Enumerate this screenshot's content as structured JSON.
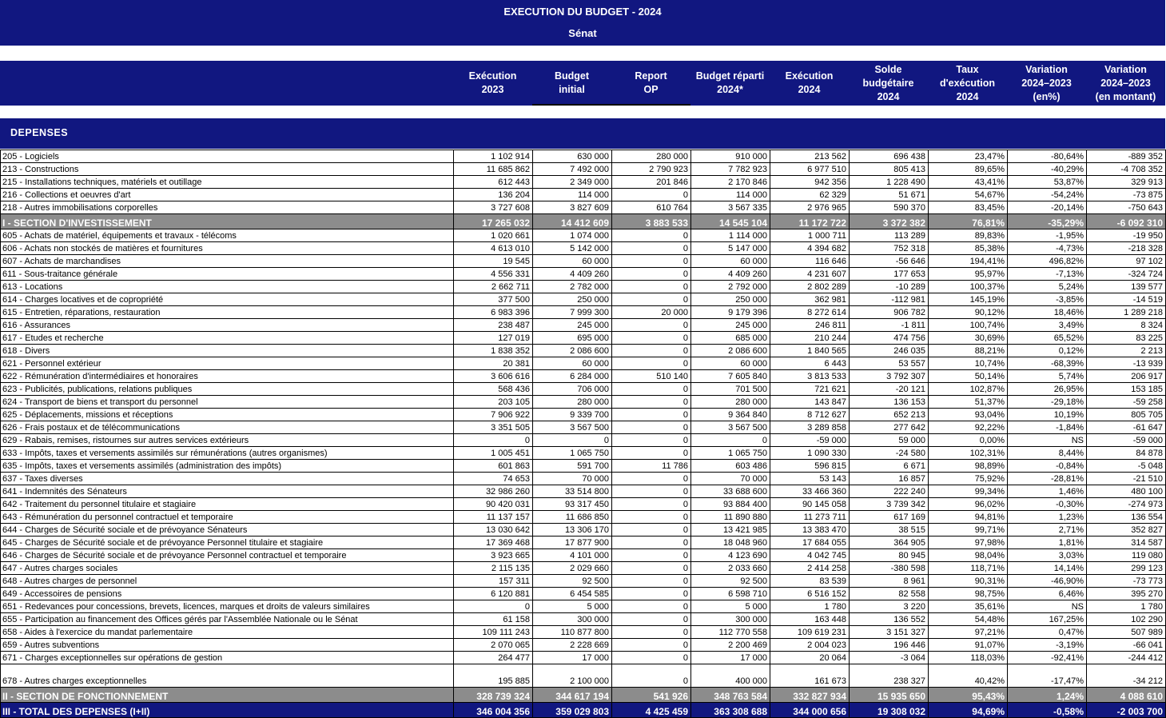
{
  "header": {
    "title": "EXECUTION DU BUDGET - 2024",
    "subtitle": "Sénat"
  },
  "columns": [
    "Exécution\n2023",
    "Budget\ninitial",
    "Report\nOP",
    "Budget réparti\n2024*",
    "Exécution\n2024",
    "Solde\nbudgétaire\n2024",
    "Taux\nd'exécution\n2024",
    "Variation\n2024–2023\n(en%)",
    "Variation\n2024–2023\n(en montant)"
  ],
  "section_label": "DEPENSES",
  "rows": [
    {
      "type": "item",
      "label": "205 - Logiciels",
      "values": [
        "1 102 914",
        "630 000",
        "280 000",
        "910 000",
        "213 562",
        "696 438",
        "23,47%",
        "-80,64%",
        "-889 352"
      ]
    },
    {
      "type": "item",
      "label": "213 - Constructions",
      "values": [
        "11 685 862",
        "7 492 000",
        "2 790 923",
        "7 782 923",
        "6 977 510",
        "805 413",
        "89,65%",
        "-40,29%",
        "-4 708 352"
      ]
    },
    {
      "type": "item",
      "label": "215 - Installations techniques, matériels et outillage",
      "values": [
        "612 443",
        "2 349 000",
        "201 846",
        "2 170 846",
        "942 356",
        "1 228 490",
        "43,41%",
        "53,87%",
        "329 913"
      ]
    },
    {
      "type": "item",
      "label": "216 - Collections et oeuvres d'art",
      "values": [
        "136 204",
        "114 000",
        "0",
        "114 000",
        "62 329",
        "51 671",
        "54,67%",
        "-54,24%",
        "-73 875"
      ]
    },
    {
      "type": "item",
      "label": "218 - Autres immobilisations corporelles",
      "values": [
        "3 727 608",
        "3 827 609",
        "610 764",
        "3 567 335",
        "2 976 965",
        "590 370",
        "83,45%",
        "-20,14%",
        "-750 643"
      ]
    },
    {
      "type": "section",
      "label": "I - SECTION D'INVESTISSEMENT",
      "values": [
        "17 265 032",
        "14 412 609",
        "3 883 533",
        "14 545 104",
        "11 172 722",
        "3 372 382",
        "76,81%",
        "-35,29%",
        "-6 092 310"
      ]
    },
    {
      "type": "item",
      "label": "605 - Achats de matériel, équipements et travaux - télécoms",
      "values": [
        "1 020 661",
        "1 074 000",
        "0",
        "1 114 000",
        "1 000 711",
        "113 289",
        "89,83%",
        "-1,95%",
        "-19 950"
      ]
    },
    {
      "type": "item",
      "label": "606 - Achats non stockés de matières et fournitures",
      "values": [
        "4 613 010",
        "5 142 000",
        "0",
        "5 147 000",
        "4 394 682",
        "752 318",
        "85,38%",
        "-4,73%",
        "-218 328"
      ]
    },
    {
      "type": "item",
      "label": "607 - Achats de marchandises",
      "values": [
        "19 545",
        "60 000",
        "0",
        "60 000",
        "116 646",
        "-56 646",
        "194,41%",
        "496,82%",
        "97 102"
      ]
    },
    {
      "type": "item",
      "label": "611 - Sous-traitance générale",
      "values": [
        "4 556 331",
        "4 409 260",
        "0",
        "4 409 260",
        "4 231 607",
        "177 653",
        "95,97%",
        "-7,13%",
        "-324 724"
      ]
    },
    {
      "type": "item",
      "label": "613 - Locations",
      "values": [
        "2 662 711",
        "2 782 000",
        "0",
        "2 792 000",
        "2 802 289",
        "-10 289",
        "100,37%",
        "5,24%",
        "139 577"
      ]
    },
    {
      "type": "item",
      "label": "614 - Charges locatives et de copropriété",
      "values": [
        "377 500",
        "250 000",
        "0",
        "250 000",
        "362 981",
        "-112 981",
        "145,19%",
        "-3,85%",
        "-14 519"
      ]
    },
    {
      "type": "item",
      "label": "615 - Entretien, réparations, restauration",
      "values": [
        "6 983 396",
        "7 999 300",
        "20 000",
        "9 179 396",
        "8 272 614",
        "906 782",
        "90,12%",
        "18,46%",
        "1 289 218"
      ]
    },
    {
      "type": "item",
      "label": "616 - Assurances",
      "values": [
        "238 487",
        "245 000",
        "0",
        "245 000",
        "246 811",
        "-1 811",
        "100,74%",
        "3,49%",
        "8 324"
      ]
    },
    {
      "type": "item",
      "label": "617 - Etudes et recherche",
      "values": [
        "127 019",
        "695 000",
        "0",
        "685 000",
        "210 244",
        "474 756",
        "30,69%",
        "65,52%",
        "83 225"
      ]
    },
    {
      "type": "item",
      "label": "618 - Divers",
      "values": [
        "1 838 352",
        "2 086 600",
        "0",
        "2 086 600",
        "1 840 565",
        "246 035",
        "88,21%",
        "0,12%",
        "2 213"
      ]
    },
    {
      "type": "item",
      "label": "621 - Personnel extérieur",
      "values": [
        "20 381",
        "60 000",
        "0",
        "60 000",
        "6 443",
        "53 557",
        "10,74%",
        "-68,39%",
        "-13 939"
      ]
    },
    {
      "type": "item",
      "label": "622 - Rémunération d'intermédiaires et honoraires",
      "values": [
        "3 606 616",
        "6 284 000",
        "510 140",
        "7 605 840",
        "3 813 533",
        "3 792 307",
        "50,14%",
        "5,74%",
        "206 917"
      ]
    },
    {
      "type": "item",
      "label": "623 - Publicités, publications, relations publiques",
      "values": [
        "568 436",
        "706 000",
        "0",
        "701 500",
        "721 621",
        "-20 121",
        "102,87%",
        "26,95%",
        "153 185"
      ]
    },
    {
      "type": "item",
      "label": "624 - Transport de biens et transport du personnel",
      "values": [
        "203 105",
        "280 000",
        "0",
        "280 000",
        "143 847",
        "136 153",
        "51,37%",
        "-29,18%",
        "-59 258"
      ]
    },
    {
      "type": "item",
      "label": "625 - Déplacements, missions et réceptions",
      "values": [
        "7 906 922",
        "9 339 700",
        "0",
        "9 364 840",
        "8 712 627",
        "652 213",
        "93,04%",
        "10,19%",
        "805 705"
      ]
    },
    {
      "type": "item",
      "label": "626 - Frais postaux et de télécommunications",
      "values": [
        "3 351 505",
        "3 567 500",
        "0",
        "3 567 500",
        "3 289 858",
        "277 642",
        "92,22%",
        "-1,84%",
        "-61 647"
      ]
    },
    {
      "type": "item",
      "label": "629 - Rabais, remises, ristournes sur autres services extérieurs",
      "values": [
        "0",
        "0",
        "0",
        "0",
        "-59 000",
        "59 000",
        "0,00%",
        "NS",
        "-59 000"
      ]
    },
    {
      "type": "item",
      "label": "633 - Impôts, taxes et versements assimilés sur rémunérations (autres organismes)",
      "values": [
        "1 005 451",
        "1 065 750",
        "0",
        "1 065 750",
        "1 090 330",
        "-24 580",
        "102,31%",
        "8,44%",
        "84 878"
      ]
    },
    {
      "type": "item",
      "label": "635 - Impôts, taxes et versements assimilés (administration des impôts)",
      "values": [
        "601 863",
        "591 700",
        "11 786",
        "603 486",
        "596 815",
        "6 671",
        "98,89%",
        "-0,84%",
        "-5 048"
      ]
    },
    {
      "type": "item",
      "label": "637 - Taxes diverses",
      "values": [
        "74 653",
        "70 000",
        "0",
        "70 000",
        "53 143",
        "16 857",
        "75,92%",
        "-28,81%",
        "-21 510"
      ]
    },
    {
      "type": "item",
      "label": "641 - Indemnités des Sénateurs",
      "values": [
        "32 986 260",
        "33 514 800",
        "0",
        "33 688 600",
        "33 466 360",
        "222 240",
        "99,34%",
        "1,46%",
        "480 100"
      ]
    },
    {
      "type": "item",
      "label": "642 - Traitement du personnel titulaire et stagiaire",
      "values": [
        "90 420 031",
        "93 317 450",
        "0",
        "93 884 400",
        "90 145 058",
        "3 739 342",
        "96,02%",
        "-0,30%",
        "-274 973"
      ]
    },
    {
      "type": "item",
      "label": "643 - Rémunération du personnel contractuel et temporaire",
      "values": [
        "11 137 157",
        "11 686 850",
        "0",
        "11 890 880",
        "11 273 711",
        "617 169",
        "94,81%",
        "1,23%",
        "136 554"
      ]
    },
    {
      "type": "item",
      "label": "644 - Charges de Sécurité sociale et de prévoyance Sénateurs",
      "values": [
        "13 030 642",
        "13 306 170",
        "0",
        "13 421 985",
        "13 383 470",
        "38 515",
        "99,71%",
        "2,71%",
        "352 827"
      ]
    },
    {
      "type": "item",
      "label": "645 - Charges de Sécurité sociale et de prévoyance Personnel titulaire et stagiaire",
      "values": [
        "17 369 468",
        "17 877 900",
        "0",
        "18 048 960",
        "17 684 055",
        "364 905",
        "97,98%",
        "1,81%",
        "314 587"
      ]
    },
    {
      "type": "item",
      "label": "646 - Charges de Sécurité sociale et de prévoyance Personnel contractuel et temporaire",
      "values": [
        "3 923 665",
        "4 101 000",
        "0",
        "4 123 690",
        "4 042 745",
        "80 945",
        "98,04%",
        "3,03%",
        "119 080"
      ]
    },
    {
      "type": "item",
      "label": "647 - Autres charges sociales",
      "values": [
        "2 115 135",
        "2 029 660",
        "0",
        "2 033 660",
        "2 414 258",
        "-380 598",
        "118,71%",
        "14,14%",
        "299 123"
      ]
    },
    {
      "type": "item",
      "label": "648 - Autres charges de personnel",
      "values": [
        "157 311",
        "92 500",
        "0",
        "92 500",
        "83 539",
        "8 961",
        "90,31%",
        "-46,90%",
        "-73 773"
      ]
    },
    {
      "type": "item",
      "label": "649 - Accessoires de pensions",
      "values": [
        "6 120 881",
        "6 454 585",
        "0",
        "6 598 710",
        "6 516 152",
        "82 558",
        "98,75%",
        "6,46%",
        "395 270"
      ]
    },
    {
      "type": "item",
      "label": "651 - Redevances pour concessions, brevets, licences, marques et droits de valeurs similaires",
      "values": [
        "0",
        "5 000",
        "0",
        "5 000",
        "1 780",
        "3 220",
        "35,61%",
        "NS",
        "1 780"
      ]
    },
    {
      "type": "item",
      "label": "655 - Participation au financement des Offices gérés par l'Assemblée Nationale ou le Sénat",
      "values": [
        "61 158",
        "300 000",
        "0",
        "300 000",
        "163 448",
        "136 552",
        "54,48%",
        "167,25%",
        "102 290"
      ]
    },
    {
      "type": "item",
      "label": "658 - Aides à l'exercice du mandat parlementaire",
      "values": [
        "109 111 243",
        "110 877 800",
        "0",
        "112 770 558",
        "109 619 231",
        "3 151 327",
        "97,21%",
        "0,47%",
        "507 989"
      ]
    },
    {
      "type": "item",
      "label": "659 - Autres subventions",
      "values": [
        "2 070 065",
        "2 228 669",
        "0",
        "2 200 469",
        "2 004 023",
        "196 446",
        "91,07%",
        "-3,19%",
        "-66 041"
      ]
    },
    {
      "type": "item",
      "label": "671 - Charges exceptionnelles sur opérations de gestion",
      "values": [
        "264 477",
        "17 000",
        "0",
        "17 000",
        "20 064",
        "-3 064",
        "118,03%",
        "-92,41%",
        "-244 412"
      ]
    },
    {
      "type": "tall",
      "label": "678 - Autres charges exceptionnelles",
      "values": [
        "195 885",
        "2 100 000",
        "0",
        "400 000",
        "161 673",
        "238 327",
        "40,42%",
        "-17,47%",
        "-34 212"
      ]
    },
    {
      "type": "section",
      "label": "II - SECTION DE FONCTIONNEMENT",
      "values": [
        "328 739 324",
        "344 617 194",
        "541 926",
        "348 763 584",
        "332 827 934",
        "15 935 650",
        "95,43%",
        "1,24%",
        "4 088 610"
      ]
    },
    {
      "type": "total",
      "label": "III - TOTAL DES DEPENSES (I+II)",
      "values": [
        "346 004 356",
        "359 029 803",
        "4 425 459",
        "363 308 688",
        "344 000 656",
        "19 308 032",
        "94,69%",
        "-0,58%",
        "-2 003 700"
      ]
    }
  ]
}
